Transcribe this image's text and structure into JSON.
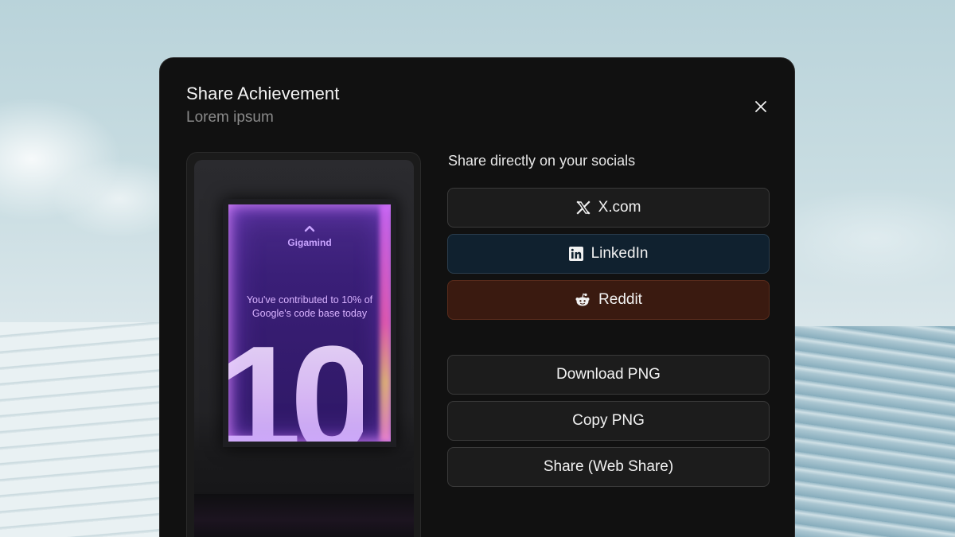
{
  "modal": {
    "title": "Share Achievement",
    "subtitle": "Lorem ipsum",
    "close_icon": "close-icon"
  },
  "preview": {
    "brand": "Gigamind",
    "message": "You've contributed to 10% of Google's code base today",
    "number": "10"
  },
  "socials": {
    "label": "Share directly on your socials",
    "buttons": [
      {
        "label": "X.com",
        "icon": "x-logo-icon",
        "bg": "#1c1c1c"
      },
      {
        "label": "LinkedIn",
        "icon": "linkedin-logo-icon",
        "bg": "#10212f"
      },
      {
        "label": "Reddit",
        "icon": "reddit-logo-icon",
        "bg": "#3a1a10"
      }
    ]
  },
  "actions": {
    "download": "Download PNG",
    "copy": "Copy PNG",
    "web_share": "Share (Web Share)"
  }
}
